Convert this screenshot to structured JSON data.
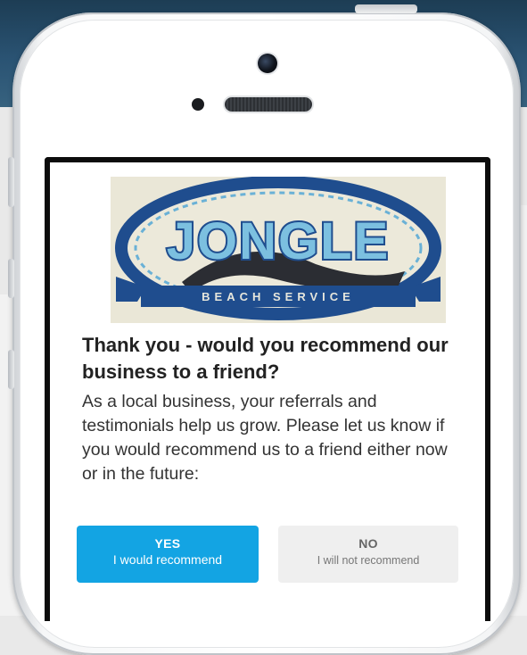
{
  "logo": {
    "main_text": "JONGLE",
    "sub_text": "BEACH SERVICE",
    "colors": {
      "blue": "#1f4d8e",
      "light_blue": "#6ab1d6",
      "cream": "#eae7d7",
      "dark": "#2b2d33"
    }
  },
  "content": {
    "question": "Thank you - would you recommend our business to a friend?",
    "description": "As a local business, your referrals and testimonials help us grow. Please let us know if you would recommend us to a friend either now or in the future:"
  },
  "buttons": {
    "yes": {
      "title": "YES",
      "subtitle": "I would recommend",
      "color": "#13a4e3"
    },
    "no": {
      "title": "NO",
      "subtitle": "I will not recommend",
      "color": "#efefef"
    }
  }
}
